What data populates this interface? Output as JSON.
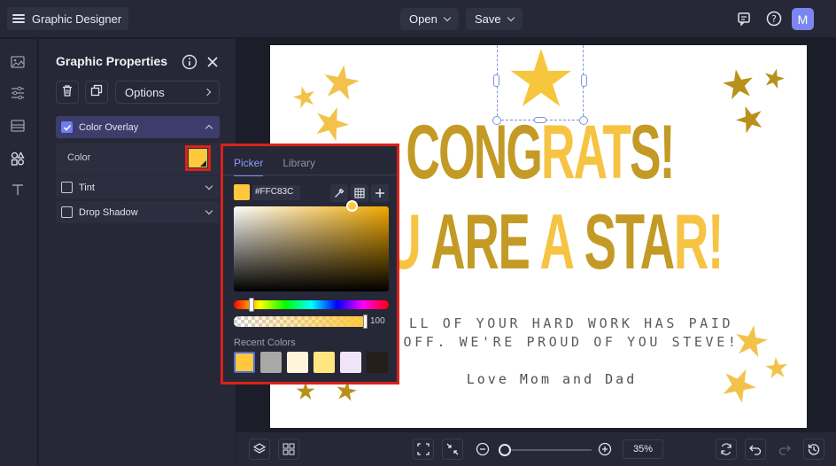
{
  "app": {
    "title": "Graphic Designer"
  },
  "topbar": {
    "open_label": "Open",
    "save_label": "Save",
    "avatar_initial": "M"
  },
  "panel": {
    "title": "Graphic Properties",
    "options_label": "Options",
    "sections": {
      "color_overlay": {
        "label": "Color Overlay",
        "checked": true,
        "expanded": true
      },
      "color_label": "Color",
      "tint": {
        "label": "Tint",
        "checked": false
      },
      "drop_shadow": {
        "label": "Drop Shadow",
        "checked": false
      }
    }
  },
  "picker": {
    "tabs": [
      "Picker",
      "Library"
    ],
    "active_tab": "Picker",
    "hex": "#FFC83C",
    "opacity": "100",
    "recent_label": "Recent Colors",
    "recent_colors": [
      "#FFC83C",
      "#A8A8A8",
      "#FFF5DC",
      "#FFE680",
      "#EFE4FA",
      "#241F1B"
    ]
  },
  "card": {
    "line1_gold": "CONG",
    "line1_yellow": "RAT",
    "line1_gold2": "S!",
    "line2_yellow1": "U ",
    "line2_gold1": "ARE",
    "line2_yellow2": " A ",
    "line2_gold2": "STA",
    "line2_yellow3": "R!",
    "message_line1": "LL OF YOUR HARD WORK HAS PAID",
    "message_line2": "OFF. WE'RE PROUD OF YOU STEVE!",
    "signature": "Love Mom and Dad",
    "colors": {
      "gold": "#C39A25",
      "yellow": "#F6C343"
    }
  },
  "bottombar": {
    "zoom": "35%"
  }
}
